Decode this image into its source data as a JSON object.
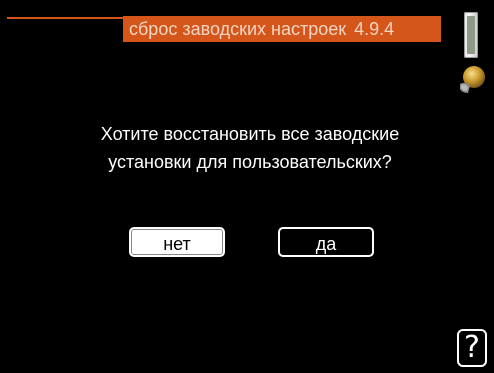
{
  "header": {
    "title": "сброс заводских настроек",
    "menu_number": "4.9.4"
  },
  "dialog": {
    "prompt_line1": "Хотите восстановить все заводские",
    "prompt_line2": "установки для пользовательских?"
  },
  "buttons": {
    "no_label": "нет",
    "yes_label": "да"
  },
  "help": {
    "symbol": "?"
  },
  "icons": {
    "scroll": "scrollbar-icon",
    "knob": "control-knob-icon",
    "help": "help-icon"
  },
  "colors": {
    "accent": "#d4561a",
    "title_text": "#f4d4c2",
    "background": "#000000",
    "text": "#ffffff"
  }
}
